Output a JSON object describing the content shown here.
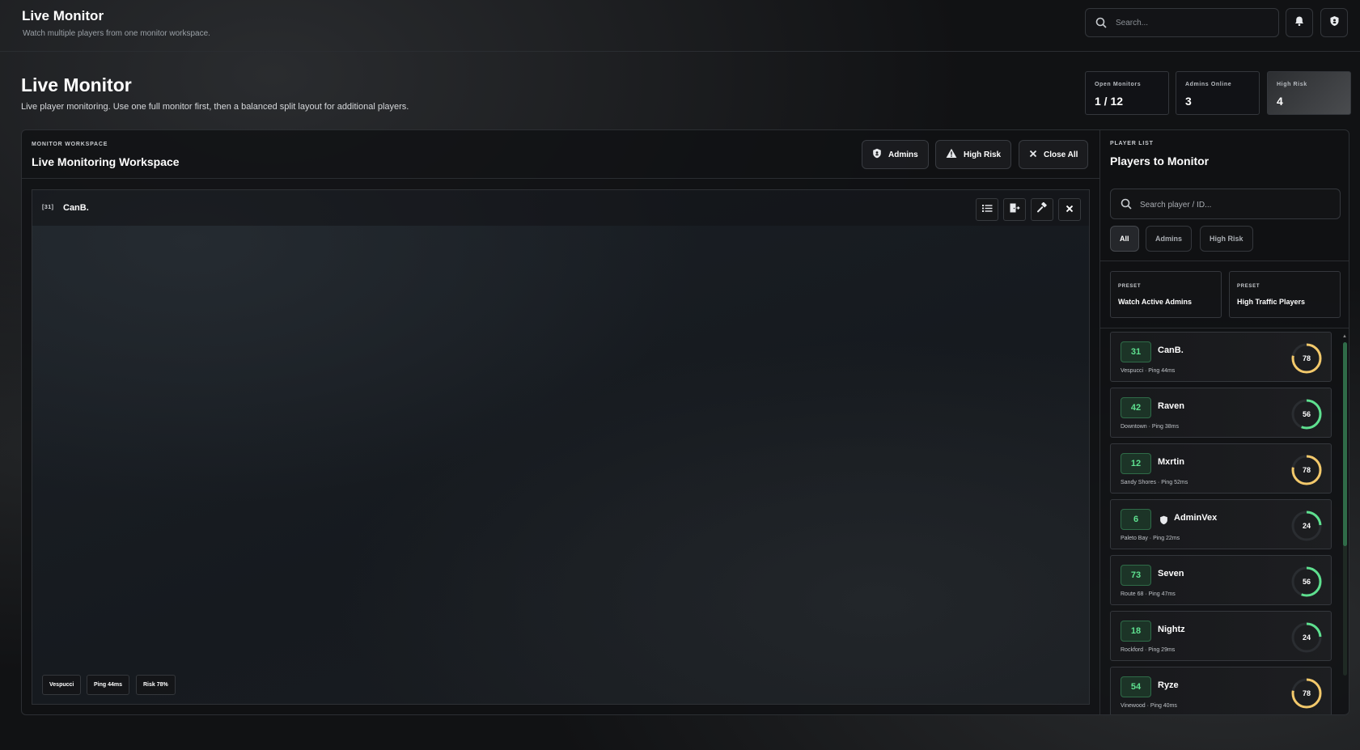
{
  "header": {
    "app_title": "Live Monitor",
    "app_subtitle": "Watch multiple players from one monitor workspace.",
    "search_placeholder": "Search...",
    "icons": [
      "bell-icon",
      "shield-icon"
    ]
  },
  "page": {
    "title": "Live Monitor",
    "description": "Live player monitoring. Use one full monitor first, then a balanced split layout for additional players."
  },
  "stats": [
    {
      "label": "Open Monitors",
      "value": "1 / 12"
    },
    {
      "label": "Admins Online",
      "value": "3"
    },
    {
      "label": "High Risk",
      "value": "4"
    }
  ],
  "workspace": {
    "kicker": "MONITOR WORKSPACE",
    "title": "Live Monitoring Workspace",
    "buttons": {
      "admins": "Admins",
      "high_risk": "High Risk",
      "close_all": "Close All"
    },
    "monitor": {
      "id": "[31]",
      "name": "CanB.",
      "tools": [
        "list-icon",
        "door-icon",
        "hammer-icon",
        "close-icon"
      ],
      "tags": [
        "Vespucci",
        "Ping 44ms",
        "Risk 78%"
      ]
    }
  },
  "player_list": {
    "kicker": "PLAYER LIST",
    "title": "Players to Monitor",
    "search_placeholder": "Search player / ID...",
    "filters": [
      "All",
      "Admins",
      "High Risk"
    ],
    "active_filter": "All",
    "presets": [
      {
        "kicker": "PRESET",
        "name": "Watch Active Admins"
      },
      {
        "kicker": "PRESET",
        "name": "High Traffic Players"
      }
    ],
    "players": [
      {
        "id": "31",
        "name": "CanB.",
        "sub": "Vespucci · Ping 44ms",
        "risk": 78,
        "admin": false
      },
      {
        "id": "42",
        "name": "Raven",
        "sub": "Downtown · Ping 38ms",
        "risk": 56,
        "admin": false
      },
      {
        "id": "12",
        "name": "Mxrtin",
        "sub": "Sandy Shores · Ping 52ms",
        "risk": 78,
        "admin": false
      },
      {
        "id": "6",
        "name": "AdminVex",
        "sub": "Paleto Bay · Ping 22ms",
        "risk": 24,
        "admin": true
      },
      {
        "id": "73",
        "name": "Seven",
        "sub": "Route 68 · Ping 47ms",
        "risk": 56,
        "admin": false
      },
      {
        "id": "18",
        "name": "Nightz",
        "sub": "Rockford · Ping 29ms",
        "risk": 24,
        "admin": false
      },
      {
        "id": "54",
        "name": "Ryze",
        "sub": "Vinewood · Ping 40ms",
        "risk": 78,
        "admin": false
      }
    ]
  },
  "colors": {
    "accent_green": "#5ee08f",
    "risk_high": "#f3c96b",
    "risk_mid": "#5ee08f",
    "risk_low": "#5ee08f"
  }
}
